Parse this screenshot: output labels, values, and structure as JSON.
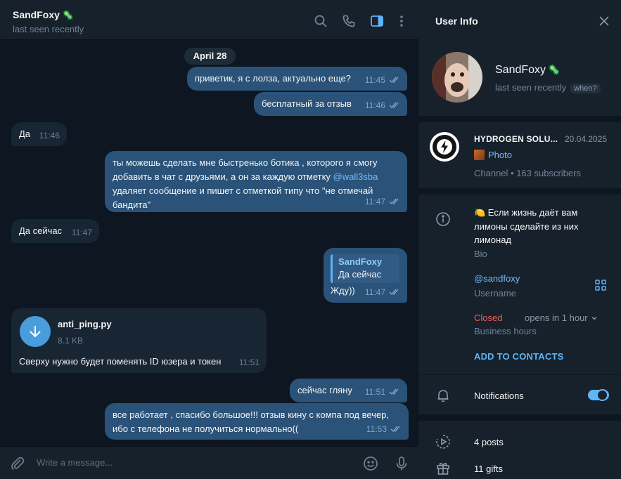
{
  "chat": {
    "contact_name": "SandFoxy",
    "contact_status": "last seen recently",
    "date_label": "April 28",
    "messages": [
      {
        "text": "приветик, я с лолза, актуально еще?",
        "time": "11:45"
      },
      {
        "text": "бесплатный за отзыв",
        "time": "11:46"
      },
      {
        "text": "Да",
        "time": "11:46"
      },
      {
        "text_line1": "ты можешь сделать мне быстренько ботика , которого я смогу",
        "text_line2a": "добавить в чат с друзьями, а он за каждую отметку ",
        "mention": "@wall3sba",
        "text_line3": "удаляет сообщение и пишет с отметкой типу что \"не отмечай",
        "text_line4": "бандита\"",
        "time": "11:47"
      },
      {
        "text": "Да сейчас",
        "time": "11:47"
      },
      {
        "reply_name": "SandFoxy",
        "reply_text": "Да сейчас",
        "text": "Жду))",
        "time": "11:47"
      },
      {
        "file_name": "anti_ping.py",
        "file_size": "8.1 KB",
        "caption": "Сверху нужно будет поменять ID юзера и токен",
        "time": "11:51"
      },
      {
        "text": "сейчас гляну",
        "time": "11:51"
      },
      {
        "text_line1": "все работает , спасибо большое!!! отзыв кину с компа  под вечер,",
        "text_line2": "ибо с телефона не получиться нормально((",
        "time": "11:53"
      }
    ],
    "composer_placeholder": "Write a message..."
  },
  "info": {
    "title": "User Info",
    "name": "SandFoxy",
    "status": "last seen recently",
    "when_chip": "when?",
    "channel": {
      "name": "HYDROGEN SOLU...",
      "date": "20.04.2025",
      "photo_label": "Photo",
      "subscribers": "Channel • 163 subscribers"
    },
    "bio": {
      "text": "🍋 Если жизнь даёт вам лимоны сделайте из них лимонад",
      "label": "Bio"
    },
    "username": {
      "value": "@sandfoxy",
      "label": "Username"
    },
    "business": {
      "closed": "Closed",
      "opens": "opens in 1 hour",
      "label": "Business hours"
    },
    "add_contacts": "ADD TO CONTACTS",
    "notifications": {
      "label": "Notifications",
      "enabled": true
    },
    "posts": "4 posts",
    "gifts": "11 gifts"
  },
  "colors": {
    "accent": "#5eb5f7",
    "outgoing_bubble": "#2b5278",
    "incoming_bubble": "#182533",
    "panel": "#17212b",
    "background": "#0e1621"
  }
}
